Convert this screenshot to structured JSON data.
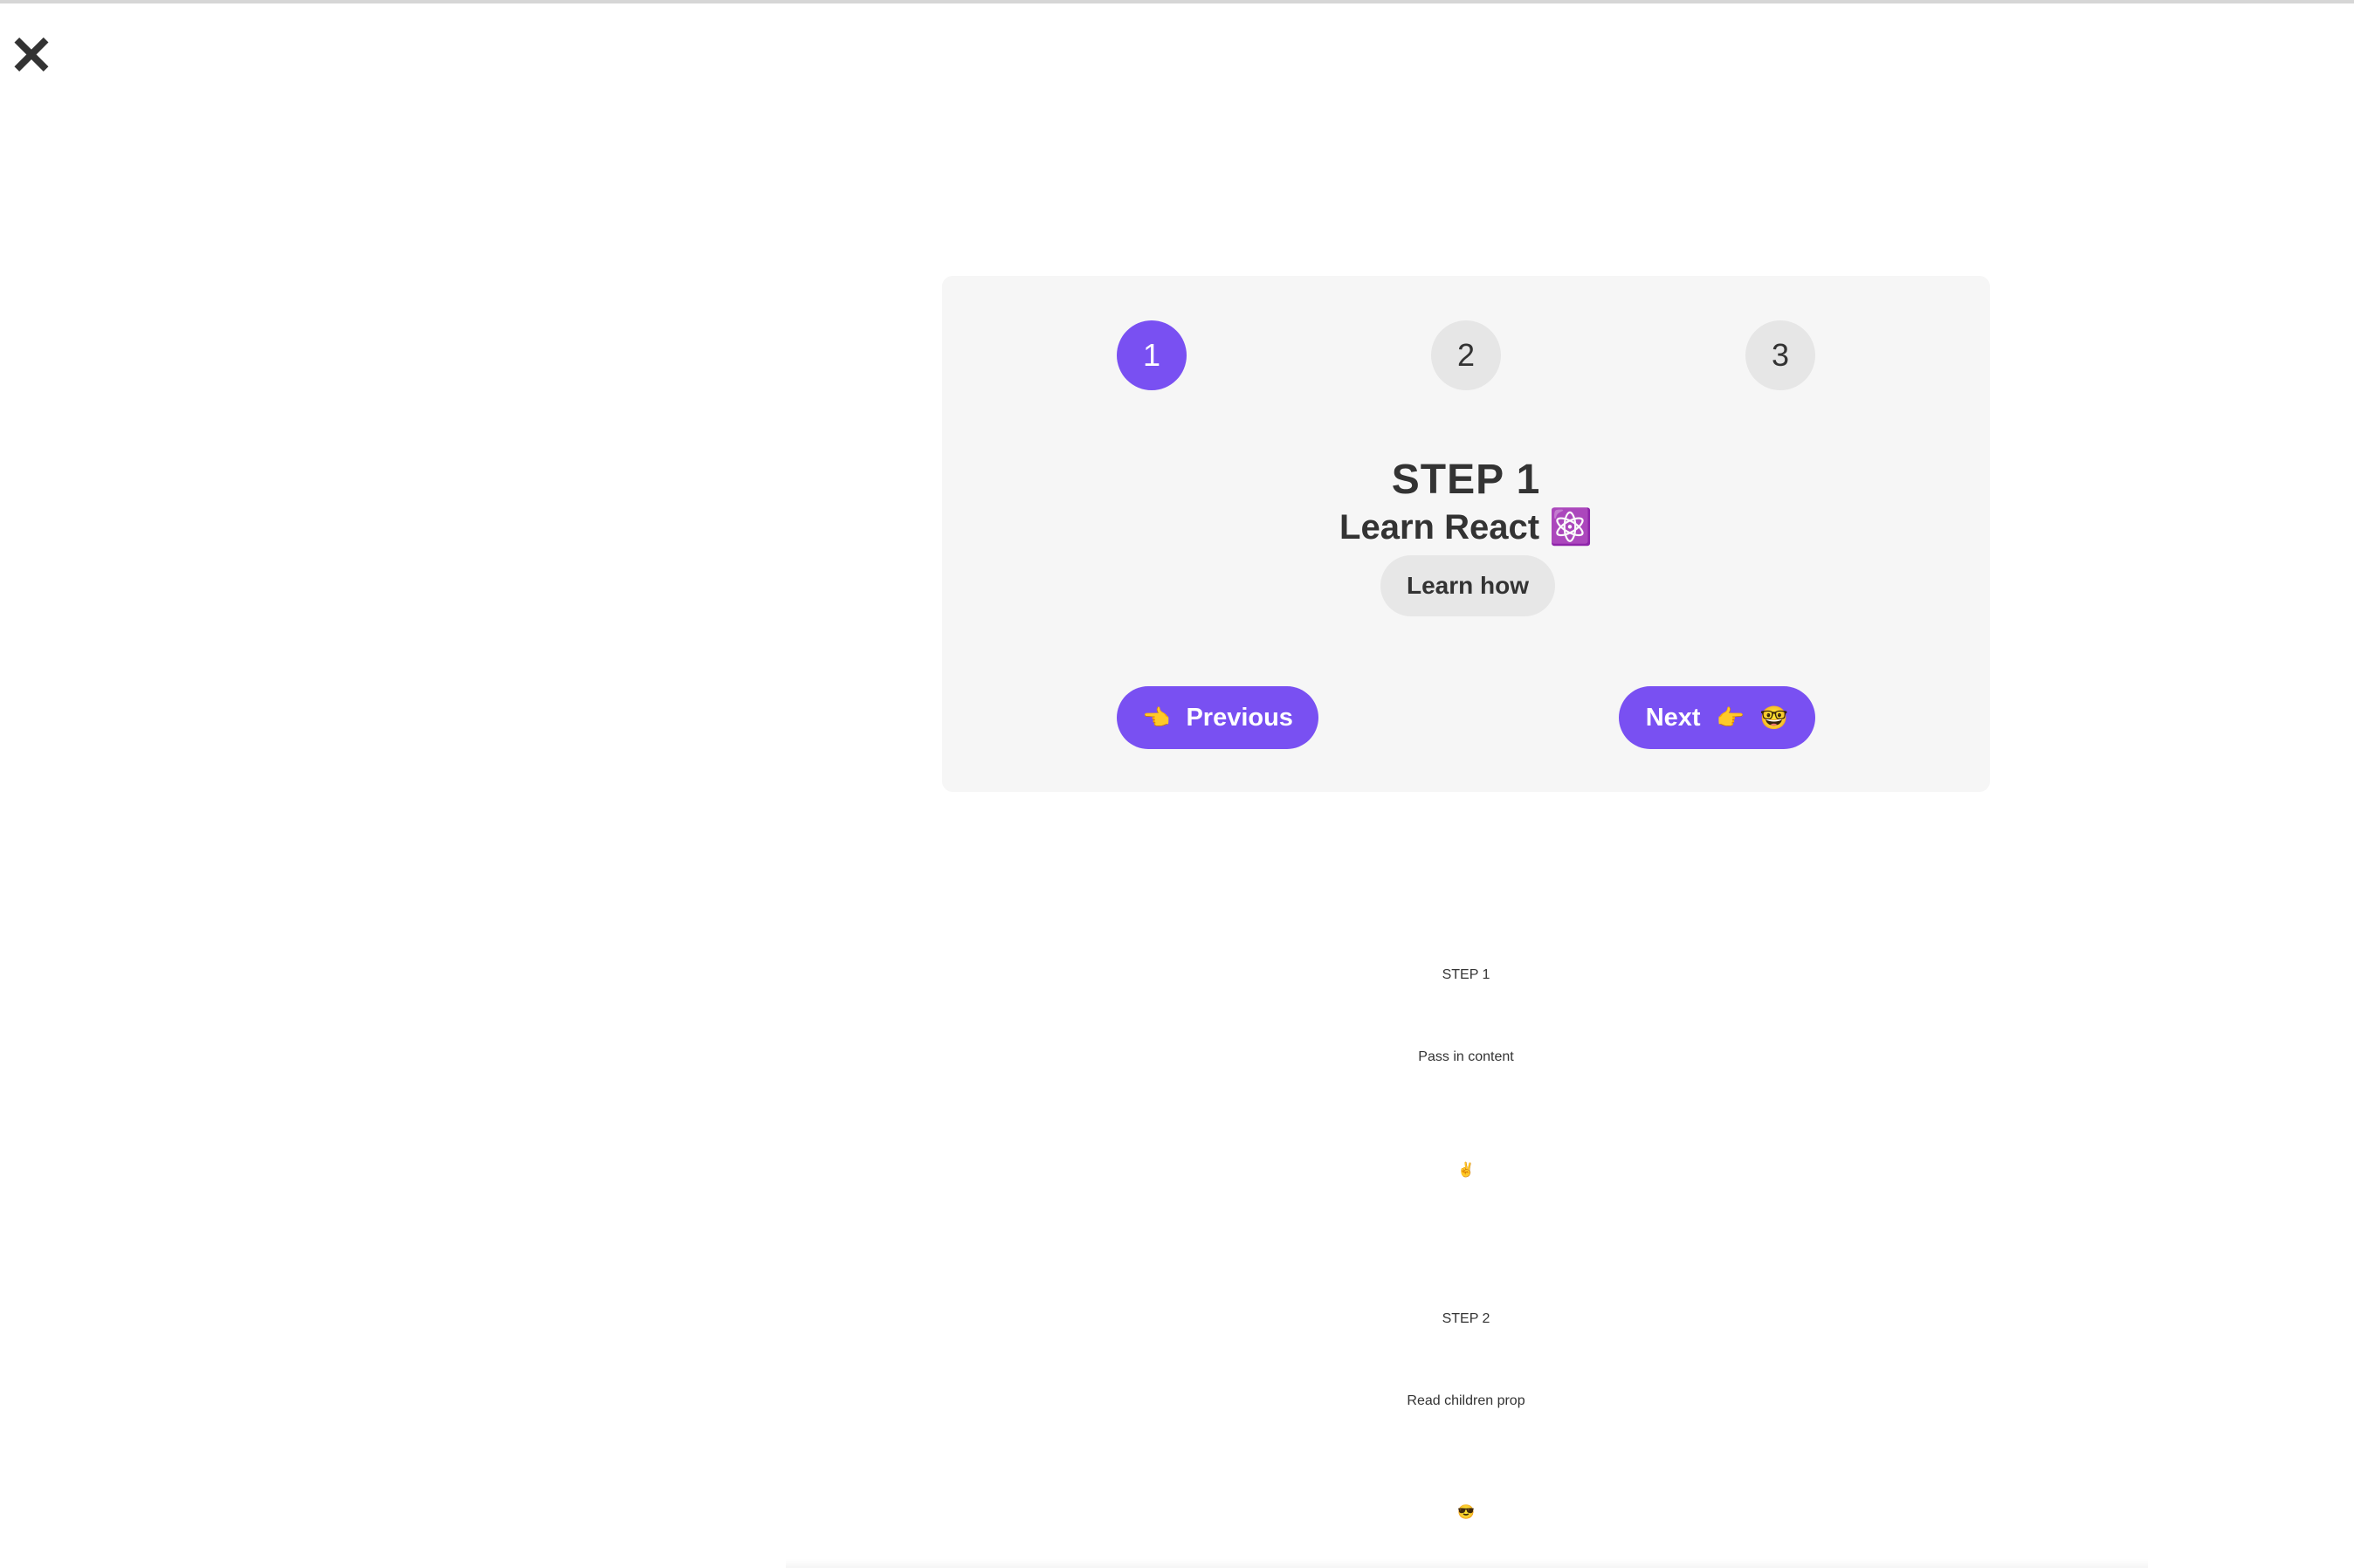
{
  "close": {
    "label": "✕"
  },
  "stepper": {
    "numbers": [
      "1",
      "2",
      "3"
    ],
    "active_index": 0,
    "title": "STEP 1",
    "message": "Learn React ⚛️",
    "learn_button": "Learn how",
    "previous_button": {
      "emoji": "👈",
      "label": "Previous"
    },
    "next_button": {
      "label": "Next",
      "emoji": "👉",
      "extra_emoji": "🤓"
    },
    "accent_color": "#7950f2"
  },
  "content_steps": [
    {
      "title": "STEP 1",
      "text": "Pass in content",
      "emoji": "✌️"
    },
    {
      "title": "STEP 2",
      "text": "Read children prop",
      "emoji": "😎"
    }
  ]
}
